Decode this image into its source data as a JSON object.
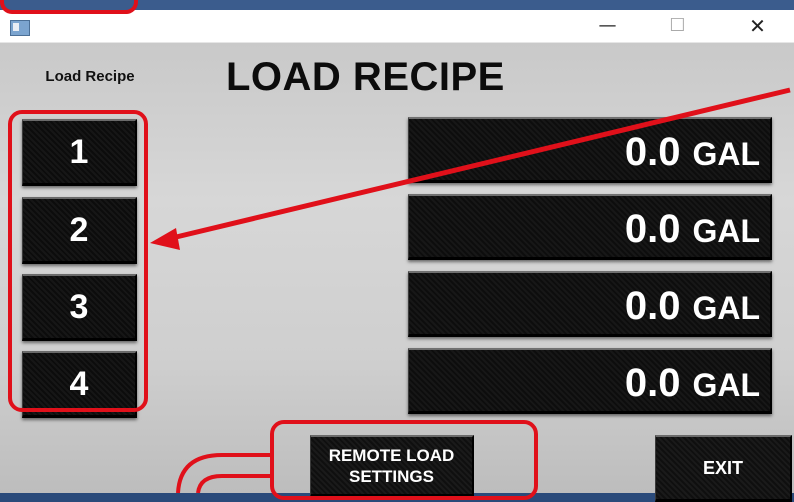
{
  "window": {
    "buttons": {
      "minimize": "—",
      "maximize": "☐",
      "close": "✕"
    }
  },
  "page": {
    "title": "LOAD RECIPE",
    "load_label": "Load Recipe"
  },
  "recipes": [
    {
      "label": "1",
      "value": "0.0",
      "unit": "GAL"
    },
    {
      "label": "2",
      "value": "0.0",
      "unit": "GAL"
    },
    {
      "label": "3",
      "value": "0.0",
      "unit": "GAL"
    },
    {
      "label": "4",
      "value": "0.0",
      "unit": "GAL"
    }
  ],
  "buttons": {
    "remote_load_line1": "REMOTE LOAD",
    "remote_load_line2": "SETTINGS",
    "exit": "EXIT"
  },
  "colors": {
    "annotation": "#e0101a",
    "button_bg": "#111111",
    "panel_bg": "#d0d0d0"
  }
}
